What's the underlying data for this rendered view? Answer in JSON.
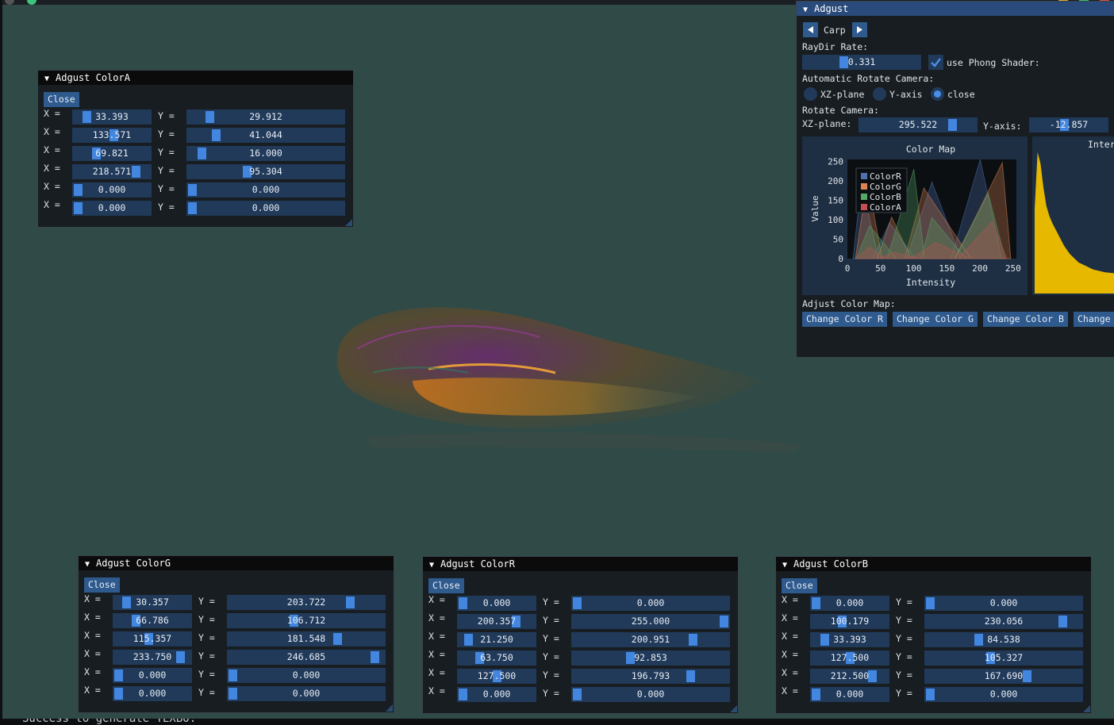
{
  "colorA": {
    "title": "Adgust ColorA",
    "close": "Close",
    "rows": [
      {
        "x": "33.393",
        "y": "29.912",
        "xf": 0.131,
        "yf": 0.117
      },
      {
        "x": "133.571",
        "y": "41.044",
        "xf": 0.524,
        "yf": 0.161
      },
      {
        "x": "69.821",
        "y": "16.000",
        "xf": 0.274,
        "yf": 0.063
      },
      {
        "x": "218.571",
        "y": "95.304",
        "xf": 0.857,
        "yf": 0.374
      },
      {
        "x": "0.000",
        "y": "0.000",
        "xf": 0,
        "yf": 0
      },
      {
        "x": "0.000",
        "y": "0.000",
        "xf": 0,
        "yf": 0
      }
    ]
  },
  "colorG": {
    "title": "Adgust ColorG",
    "close": "Close",
    "rows": [
      {
        "x": "30.357",
        "y": "203.722",
        "xf": 0.119,
        "yf": 0.799
      },
      {
        "x": "66.786",
        "y": "106.712",
        "xf": 0.262,
        "yf": 0.418
      },
      {
        "x": "115.357",
        "y": "181.548",
        "xf": 0.452,
        "yf": 0.712
      },
      {
        "x": "233.750",
        "y": "246.685",
        "xf": 0.917,
        "yf": 0.967
      },
      {
        "x": "0.000",
        "y": "0.000",
        "xf": 0,
        "yf": 0
      },
      {
        "x": "0.000",
        "y": "0.000",
        "xf": 0,
        "yf": 0
      }
    ]
  },
  "colorR": {
    "title": "Adgust ColorR",
    "close": "Close",
    "rows": [
      {
        "x": "0.000",
        "y": "0.000",
        "xf": 0,
        "yf": 0
      },
      {
        "x": "200.357",
        "y": "255.000",
        "xf": 0.786,
        "yf": 1.0
      },
      {
        "x": "21.250",
        "y": "200.951",
        "xf": 0.083,
        "yf": 0.788
      },
      {
        "x": "63.750",
        "y": "92.853",
        "xf": 0.25,
        "yf": 0.364
      },
      {
        "x": "127.500",
        "y": "196.793",
        "xf": 0.5,
        "yf": 0.772
      },
      {
        "x": "0.000",
        "y": "0.000",
        "xf": 0,
        "yf": 0
      }
    ]
  },
  "colorB": {
    "title": "Adgust ColorB",
    "close": "Close",
    "rows": [
      {
        "x": "0.000",
        "y": "0.000",
        "xf": 0,
        "yf": 0
      },
      {
        "x": "100.179",
        "y": "230.056",
        "xf": 0.393,
        "yf": 0.902
      },
      {
        "x": "33.393",
        "y": "84.538",
        "xf": 0.131,
        "yf": 0.332
      },
      {
        "x": "127.500",
        "y": "105.327",
        "xf": 0.5,
        "yf": 0.413
      },
      {
        "x": "212.500",
        "y": "167.690",
        "xf": 0.833,
        "yf": 0.658
      },
      {
        "x": "0.000",
        "y": "0.000",
        "xf": 0,
        "yf": 0
      }
    ]
  },
  "labels": {
    "x_eq": "X =",
    "y_eq": "Y ="
  },
  "adjust": {
    "title": "Adgust",
    "dataset": "Carp",
    "raydir_label": "RayDir Rate:",
    "raydir_value": "0.331",
    "raydir_fraction": 0.331,
    "phong_label": "use Phong Shader:",
    "phong_checked": true,
    "auto_rotate_label": "Automatic Rotate Camera:",
    "radio_xz": "XZ-plane",
    "radio_y": "Y-axis",
    "radio_close": "close",
    "selected_radio": "close",
    "rotate_label": "Rotate Camera:",
    "xz_label": "XZ-plane:",
    "xz_value": "295.522",
    "xz_fraction": 0.82,
    "yaxis_label": "Y-axis:",
    "yaxis_value": "-12.857",
    "yaxis_fraction": 0.43,
    "adjust_map_label": "Adjust Color Map:",
    "buttons": [
      "Change Color R",
      "Change Color G",
      "Change Color B",
      "Change"
    ],
    "inter_label": "Inter"
  },
  "chart_data": [
    {
      "type": "area",
      "title": "Color Map",
      "xlabel": "Intensity",
      "ylabel": "Value",
      "xlim": [
        0,
        255
      ],
      "ylim": [
        0,
        255
      ],
      "xticks": [
        "0",
        "50",
        "100",
        "150",
        "200",
        "250"
      ],
      "yticks": [
        "0",
        "50",
        "100",
        "150",
        "200",
        "250"
      ],
      "legend_position": "top-left",
      "series": [
        {
          "name": "ColorR",
          "color": "#4c72b0",
          "points": [
            [
              0,
              0
            ],
            [
              21.25,
              200.951
            ],
            [
              63.75,
              92.853
            ],
            [
              127.5,
              196.793
            ],
            [
              200.357,
              255.0
            ],
            [
              255,
              0
            ]
          ]
        },
        {
          "name": "ColorG",
          "color": "#dd8452",
          "points": [
            [
              0,
              0
            ],
            [
              30.357,
              203.722
            ],
            [
              66.786,
              106.712
            ],
            [
              115.357,
              181.548
            ],
            [
              233.75,
              246.685
            ],
            [
              255,
              0
            ]
          ]
        },
        {
          "name": "ColorB",
          "color": "#55a868",
          "points": [
            [
              0,
              0
            ],
            [
              33.393,
              84.538
            ],
            [
              100.179,
              230.056
            ],
            [
              127.5,
              105.327
            ],
            [
              212.5,
              167.69
            ],
            [
              255,
              0
            ]
          ]
        },
        {
          "name": "ColorA",
          "color": "#c44e52",
          "points": [
            [
              0,
              0
            ],
            [
              33.393,
              29.912
            ],
            [
              69.821,
              16.0
            ],
            [
              133.571,
              41.044
            ],
            [
              218.571,
              95.304
            ],
            [
              255,
              0
            ]
          ]
        }
      ]
    },
    {
      "type": "area",
      "title": "Inter",
      "color": "#e6b800",
      "values": [
        0.6,
        1.0,
        0.92,
        0.75,
        0.62,
        0.55,
        0.5,
        0.46,
        0.42,
        0.38,
        0.34,
        0.31,
        0.28,
        0.26,
        0.24,
        0.22,
        0.21,
        0.2,
        0.19,
        0.18,
        0.17,
        0.165,
        0.16,
        0.155,
        0.15,
        0.148,
        0.146,
        0.144,
        0.142,
        0.14
      ]
    }
  ]
}
